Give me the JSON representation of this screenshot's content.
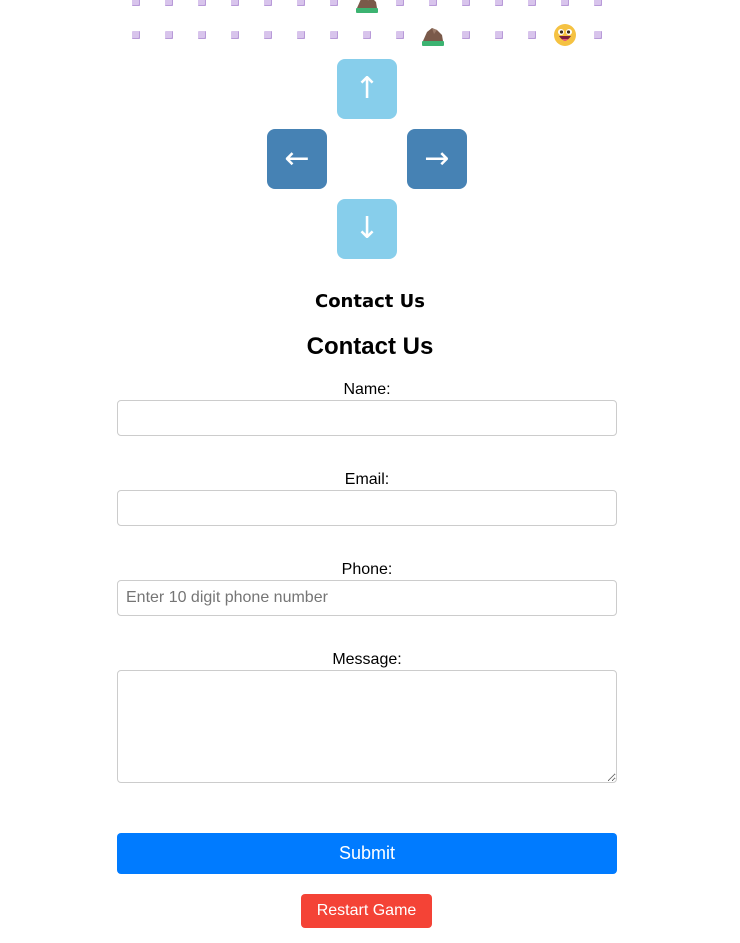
{
  "game": {
    "rows": [
      [
        "dot",
        "dot",
        "dot",
        "dot",
        "dot",
        "dot",
        "dot",
        "rock",
        "dot",
        "dot",
        "dot",
        "dot",
        "dot",
        "dot",
        "dot"
      ],
      [
        "dot",
        "dot",
        "dot",
        "dot",
        "dot",
        "dot",
        "dot",
        "dot",
        "dot",
        "rock",
        "dot",
        "dot",
        "dot",
        "player",
        "dot"
      ]
    ],
    "colors": {
      "pellet": "#d8c4ec",
      "rock": "#7a5a4a",
      "grass": "#3cb371",
      "player": "#f5c242"
    }
  },
  "controls": {
    "up": "↑",
    "left": "←",
    "right": "→",
    "down": "↓",
    "colors": {
      "vertical": "#87ceeb",
      "horizontal": "#4682b4"
    }
  },
  "contact": {
    "section_heading": "Contact Us",
    "form_heading": "Contact Us",
    "name_label": "Name:",
    "name_value": "",
    "email_label": "Email:",
    "email_value": "",
    "phone_label": "Phone:",
    "phone_placeholder": "Enter 10 digit phone number",
    "phone_value": "",
    "message_label": "Message:",
    "message_value": "",
    "submit_label": "Submit"
  },
  "restart_label": "Restart Game",
  "colors": {
    "submit": "#007bff",
    "restart": "#f44336"
  }
}
